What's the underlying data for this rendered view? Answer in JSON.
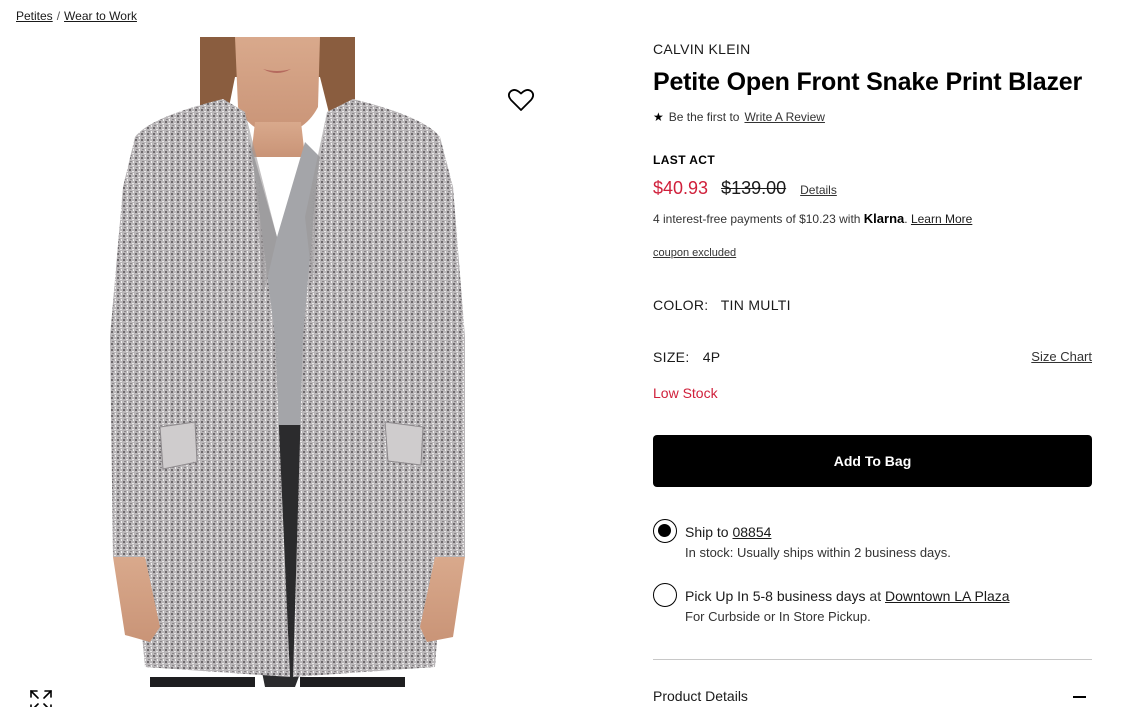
{
  "breadcrumb": {
    "items": [
      "Petites",
      "Wear to Work"
    ],
    "separator": "/"
  },
  "product": {
    "brand": "CALVIN KLEIN",
    "title": "Petite Open Front Snake Print Blazer",
    "review": {
      "star_icon": "★",
      "prompt": "Be the first to",
      "link": "Write A Review"
    },
    "promo_tag": "LAST ACT",
    "price": {
      "sale": "$40.93",
      "original": "$139.00",
      "details_link": "Details",
      "sale_color": "#d0203b"
    },
    "klarna": {
      "text": "4 interest-free payments of $10.23 with",
      "brand": "Klarna",
      "dot": ".",
      "learn_more": "Learn More"
    },
    "coupon": "coupon excluded",
    "color": {
      "label": "COLOR:",
      "value": "TIN MULTI"
    },
    "size": {
      "label": "SIZE:",
      "value": "4P",
      "chart_link": "Size Chart"
    },
    "stock_status": "Low Stock",
    "add_to_bag": "Add To Bag"
  },
  "fulfillment": {
    "ship": {
      "selected": true,
      "label": "Ship to",
      "zip": "08854",
      "note": "In stock: Usually ships within 2 business days."
    },
    "pickup": {
      "selected": false,
      "label": "Pick Up In 5-8 business days",
      "at": "at",
      "store": "Downtown LA Plaza",
      "note": "For Curbside or In Store Pickup."
    }
  },
  "accordion": {
    "product_details": "Product Details",
    "icon": "minus-icon"
  },
  "icons": {
    "favorite": "heart-icon",
    "expand": "expand-icon"
  }
}
